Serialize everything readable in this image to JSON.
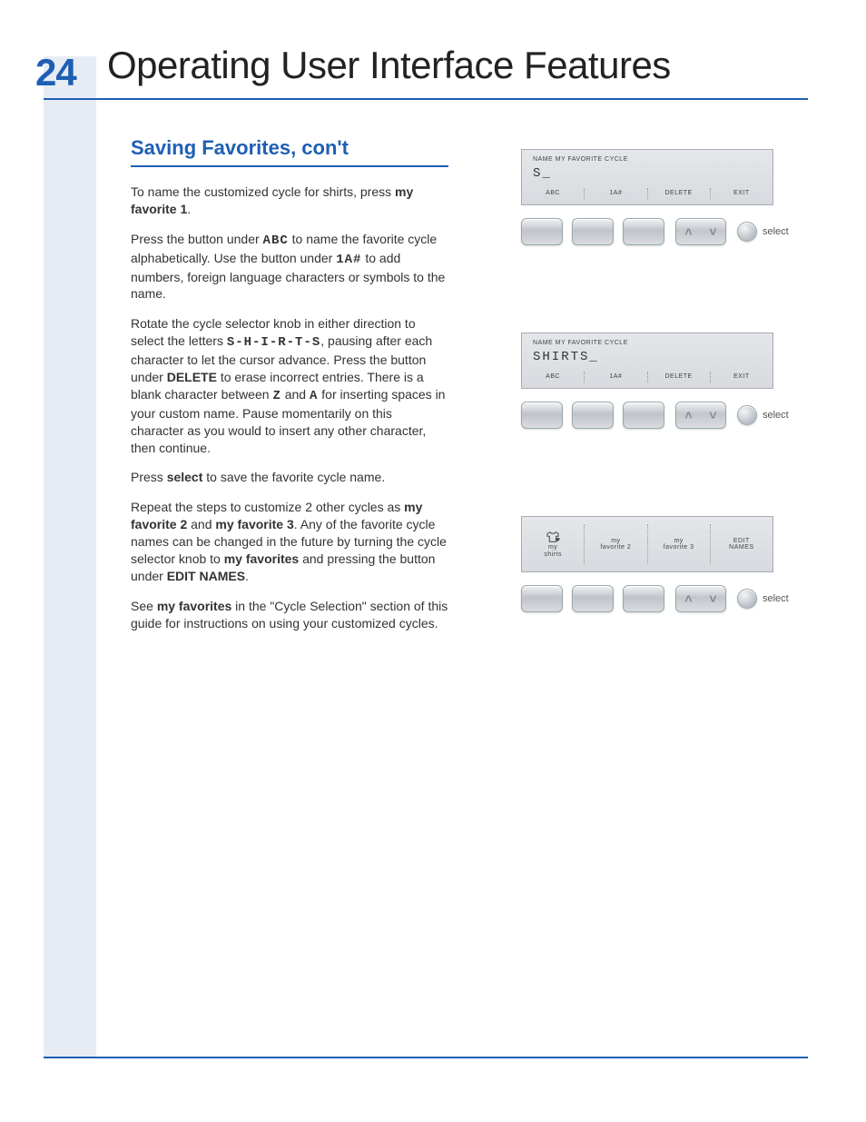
{
  "page_number": "24",
  "page_title": "Operating User Interface Features",
  "section_heading": "Saving Favorites, con't",
  "paragraphs": {
    "p1a": "To name the customized cycle for shirts, press ",
    "p1b": "my favorite 1",
    "p1c": ".",
    "p2a": "Press the button under ",
    "p2b": "ABC",
    "p2c": " to name the favorite cycle alphabetically. Use the button under ",
    "p2d": "1A#",
    "p2e": " to add numbers, foreign language characters or symbols to the name.",
    "p3a": "Rotate the cycle selector knob in either direction to select the letters ",
    "p3b": "S-H-I-R-T-S",
    "p3c": ", pausing after each character to let the cursor advance. Press the button under ",
    "p3d": "DELETE",
    "p3e": " to erase incorrect entries. There is a blank character between ",
    "p3f": "Z",
    "p3g": " and ",
    "p3h": "A",
    "p3i": " for inserting spaces in your custom name. Pause momentarily on this character as you would to insert any other character, then continue.",
    "p4a": "Press ",
    "p4b": "select",
    "p4c": " to save the favorite cycle name.",
    "p5a": "Repeat the steps to customize 2 other cycles as ",
    "p5b": "my favorite 2",
    "p5c": " and ",
    "p5d": "my favorite 3",
    "p5e": ". Any of the favorite cycle names can be changed in the future by turning the cycle selector knob to ",
    "p5f": "my favorites",
    "p5g": " and pressing the button under ",
    "p5h": "EDIT NAMES",
    "p5i": ".",
    "p6a": "See ",
    "p6b": "my favorites",
    "p6c": " in the \"Cycle Selection\" section of this guide for instructions on using your customized cycles."
  },
  "device1": {
    "lcd_title": "NAME MY FAVORITE CYCLE",
    "lcd_text": "S_",
    "opts": [
      "ABC",
      "1A#",
      "DELETE",
      "EXIT"
    ],
    "select_label": "select"
  },
  "device2": {
    "lcd_title": "NAME MY FAVORITE CYCLE",
    "lcd_text": "SHIRTS_",
    "opts": [
      "ABC",
      "1A#",
      "DELETE",
      "EXIT"
    ],
    "select_label": "select"
  },
  "device3": {
    "opts": [
      "my\nshirts",
      "my\nfavorite 2",
      "my\nfavorite 3",
      "EDIT\nNAMES"
    ],
    "select_label": "select"
  }
}
